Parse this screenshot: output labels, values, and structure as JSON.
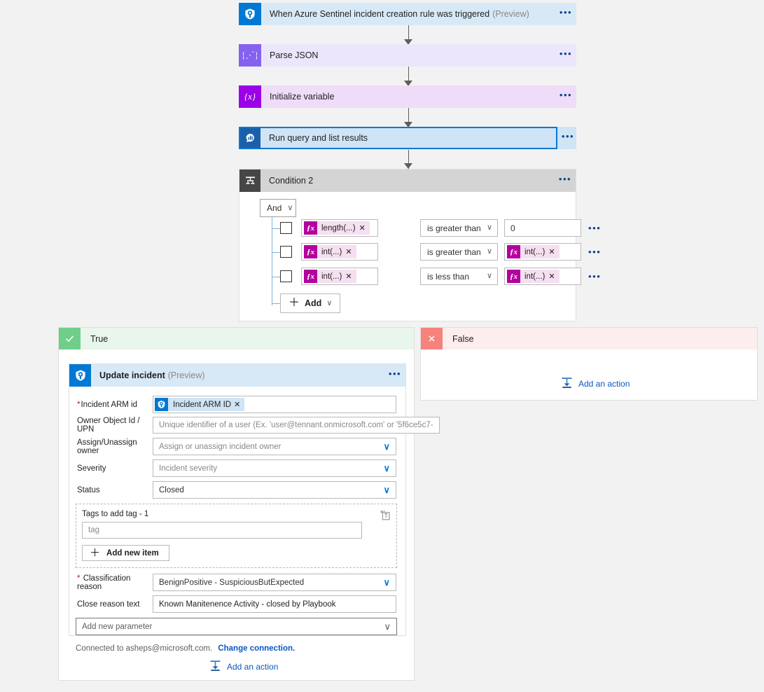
{
  "canvas": {
    "bg": "#f2f2f2"
  },
  "flow": {
    "steps": [
      {
        "name": "trigger",
        "title": "When Azure Sentinel incident creation rule was triggered",
        "suffix": "(Preview)",
        "icon": "azure-sentinel-icon",
        "icon_bg": "#0078d4",
        "header_bg": "#d7e9f7",
        "selected": false,
        "menu": "•••"
      },
      {
        "name": "parse-json",
        "title": "Parse JSON",
        "suffix": "",
        "icon": "parse-json-icon",
        "icon_bg": "#8661f0",
        "header_bg": "#ebe6fc",
        "selected": false,
        "menu": "•••"
      },
      {
        "name": "initialize-variable",
        "title": "Initialize variable",
        "suffix": "",
        "icon": "variable-icon",
        "icon_bg": "#9b00e8",
        "header_bg": "#eedcf8",
        "selected": false,
        "menu": "•••"
      },
      {
        "name": "run-query",
        "title": "Run query and list results",
        "suffix": "",
        "icon": "log-analytics-icon",
        "icon_bg": "#1b5fa8",
        "header_bg": "#cfe4f5",
        "selected": true,
        "menu": "•••"
      }
    ]
  },
  "condition": {
    "title": "Condition 2",
    "icon": "condition-icon",
    "menu": "•••",
    "logic_operator": "And",
    "logic_chevron": "∨",
    "add_button": {
      "plus": "＋",
      "label": "Add",
      "chevron": "∨"
    },
    "rows": [
      {
        "left": {
          "type": "token",
          "fx": "ƒx",
          "text": "length(...)",
          "close": "✕"
        },
        "operator": "is greater than",
        "right": {
          "type": "text",
          "value": "0"
        },
        "menu": "•••"
      },
      {
        "left": {
          "type": "token",
          "fx": "ƒx",
          "text": "int(...)",
          "close": "✕"
        },
        "operator": "is greater than",
        "right": {
          "type": "token",
          "fx": "ƒx",
          "text": "int(...)",
          "close": "✕"
        },
        "menu": "•••"
      },
      {
        "left": {
          "type": "token",
          "fx": "ƒx",
          "text": "int(...)",
          "close": "✕"
        },
        "operator": "is less than",
        "right": {
          "type": "token",
          "fx": "ƒx",
          "text": "int(...)",
          "close": "✕"
        },
        "menu": "•••"
      }
    ]
  },
  "branches": {
    "true": {
      "label": "True",
      "badge": "✓",
      "badge_bg": "#6fcf8a",
      "header_bg": "#e8f6ec",
      "add_action": "Add an action"
    },
    "false": {
      "label": "False",
      "badge": "✕",
      "badge_bg": "#f5827b",
      "header_bg": "#fdeeee",
      "add_action": "Add an action"
    }
  },
  "update_incident": {
    "title": "Update incident",
    "suffix": "(Preview)",
    "icon": "azure-sentinel-icon",
    "menu": "•••",
    "fields": {
      "incident_arm_id": {
        "label": "Incident ARM id",
        "required": true,
        "token": {
          "text": "Incident ARM ID",
          "close": "✕",
          "icon": "azure-sentinel-icon"
        }
      },
      "owner": {
        "label": "Owner Object Id / UPN",
        "placeholder": "Unique identifier of a user (Ex. 'user@tennant.onmicrosoft.com' or '5f6ce5c7-"
      },
      "assign_unassign": {
        "label": "Assign/Unassign owner",
        "value": "Assign or unassign incident owner",
        "is_placeholder": true,
        "chevron": "∨"
      },
      "severity": {
        "label": "Severity",
        "value": "Incident severity",
        "is_placeholder": true,
        "chevron": "∨"
      },
      "status": {
        "label": "Status",
        "value": "Closed",
        "is_placeholder": false,
        "chevron": "∨"
      },
      "tags": {
        "title": "Tags to add tag - 1",
        "delete_icon": "delete-icon",
        "item_placeholder": "tag",
        "add_item": {
          "plus": "＋",
          "label": "Add new item"
        }
      },
      "classification_reason": {
        "label": "Classification reason",
        "required": true,
        "value": "BenignPositive - SuspiciousButExpected",
        "chevron": "∨"
      },
      "close_reason_text": {
        "label": "Close reason text",
        "value": "Known Manitenence Activity - closed by Playbook"
      },
      "add_new_parameter": {
        "value": "Add new parameter",
        "chevron": "∨"
      }
    },
    "connection": {
      "text": "Connected to asheps@microsoft.com.",
      "link": "Change connection."
    }
  },
  "colors": {
    "accent": "#0078d4",
    "link": "#0b57c2",
    "token_magenta": "#b4009e",
    "true_green": "#6fcf8a",
    "false_red": "#f5827b"
  }
}
